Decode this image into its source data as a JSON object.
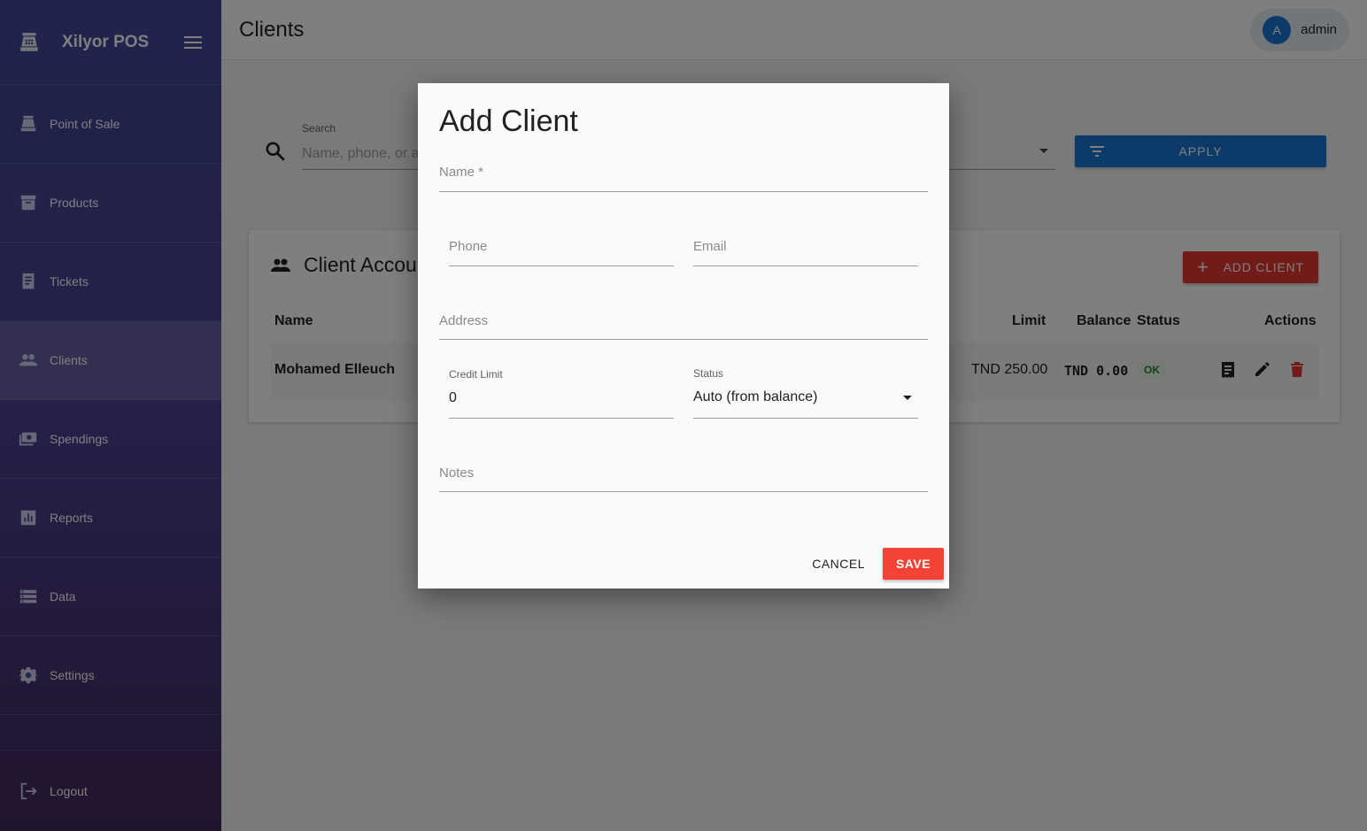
{
  "app": {
    "brand": "Xilyor POS"
  },
  "sidebar": {
    "items": [
      {
        "label": "Point of Sale",
        "icon": "cash-register-icon"
      },
      {
        "label": "Products",
        "icon": "archive-box-icon"
      },
      {
        "label": "Tickets",
        "icon": "receipt-icon"
      },
      {
        "label": "Clients",
        "icon": "people-icon",
        "active": true
      },
      {
        "label": "Spendings",
        "icon": "money-icon"
      },
      {
        "label": "Reports",
        "icon": "bar-chart-icon"
      },
      {
        "label": "Data",
        "icon": "storage-icon"
      },
      {
        "label": "Settings",
        "icon": "gear-icon"
      }
    ],
    "logout_label": "Logout"
  },
  "header": {
    "title": "Clients",
    "user": {
      "initial": "A",
      "name": "admin"
    }
  },
  "search": {
    "label": "Search",
    "placeholder": "Name, phone, or address",
    "apply_label": "APPLY"
  },
  "card": {
    "title": "Client Accounts",
    "add_label": "ADD CLIENT",
    "columns": [
      "Name",
      "Limit",
      "Balance",
      "Status",
      "Actions"
    ],
    "rows": [
      {
        "name": "Mohamed Elleuch",
        "limit": "TND 250.00",
        "balance": "TND 0.00",
        "status": "OK"
      }
    ]
  },
  "modal": {
    "title": "Add Client",
    "fields": {
      "name": {
        "label": "Name *"
      },
      "phone": {
        "label": "Phone"
      },
      "email": {
        "label": "Email"
      },
      "address": {
        "label": "Address"
      },
      "credit_limit": {
        "label": "Credit Limit",
        "value": "0"
      },
      "status": {
        "label": "Status",
        "value": "Auto (from balance)"
      },
      "notes": {
        "label": "Notes"
      }
    },
    "cancel_label": "CANCEL",
    "save_label": "SAVE"
  },
  "colors": {
    "primary": "#1976d2",
    "danger": "#f44336",
    "sidebar_top": "#3f4797",
    "sidebar_bottom": "#43295a"
  }
}
